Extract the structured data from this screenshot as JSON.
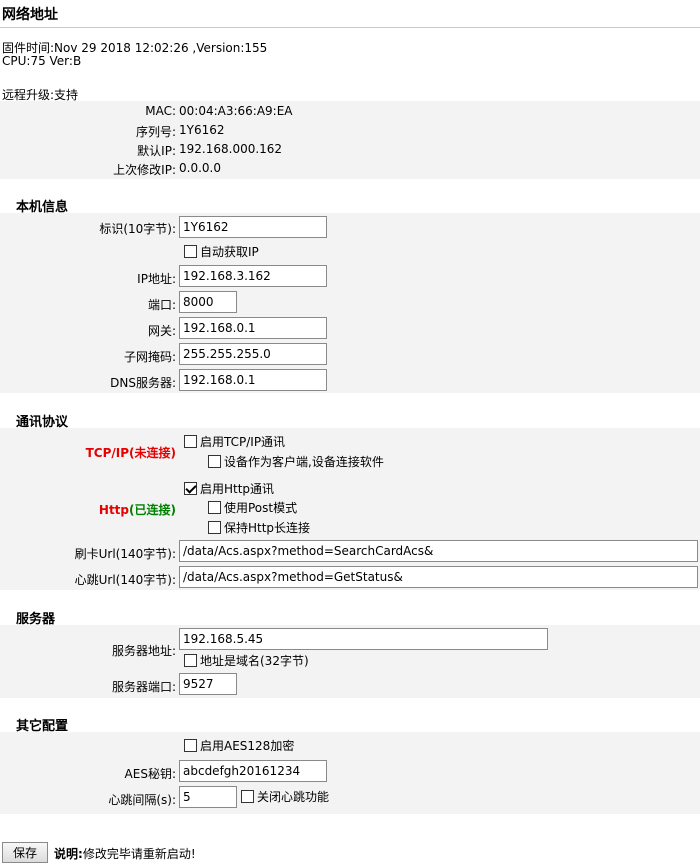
{
  "page_title": "网络地址",
  "firmware_line": "固件时间:Nov 29 2018 12:02:26 ,Version:155",
  "cpu_line": "CPU:75 Ver:B",
  "remote_upgrade": "远程升级:支持",
  "device_info": {
    "mac_label": "MAC:",
    "mac_value": "00:04:A3:66:A9:EA",
    "serial_label": "序列号:",
    "serial_value": "1Y6162",
    "default_ip_label": "默认IP:",
    "default_ip_value": "192.168.000.162",
    "last_ip_label": "上次修改IP:",
    "last_ip_value": "0.0.0.0"
  },
  "local_info": {
    "section_title": "本机信息",
    "id_label": "标识(10字节):",
    "id_value": "1Y6162",
    "auto_ip_label": "自动获取IP",
    "auto_ip_checked": false,
    "ip_label": "IP地址:",
    "ip_value": "192.168.3.162",
    "port_label": "端口:",
    "port_value": "8000",
    "gateway_label": "网关:",
    "gateway_value": "192.168.0.1",
    "mask_label": "子网掩码:",
    "mask_value": "255.255.255.0",
    "dns_label": "DNS服务器:",
    "dns_value": "192.168.0.1"
  },
  "protocol": {
    "section_title": "通讯协议",
    "tcp_label_main": "TCP/IP",
    "tcp_label_status": "(未连接)",
    "tcp_enable_label": "启用TCP/IP通讯",
    "tcp_enable_checked": false,
    "tcp_client_label": "设备作为客户端,设备连接软件",
    "tcp_client_checked": false,
    "http_label_main": "Http",
    "http_label_status": "(已连接)",
    "http_enable_label": "启用Http通讯",
    "http_enable_checked": true,
    "post_mode_label": "使用Post模式",
    "post_mode_checked": false,
    "keepalive_label": "保持Http长连接",
    "keepalive_checked": false,
    "card_url_label": "刷卡Url(140字节):",
    "card_url_value": "/data/Acs.aspx?method=SearchCardAcs&",
    "heartbeat_url_label": "心跳Url(140字节):",
    "heartbeat_url_value": "/data/Acs.aspx?method=GetStatus&"
  },
  "server": {
    "section_title": "服务器",
    "address_label": "服务器地址:",
    "address_value": "192.168.5.45",
    "is_domain_label": "地址是域名(32字节)",
    "is_domain_checked": false,
    "port_label": "服务器端口:",
    "port_value": "9527"
  },
  "other": {
    "section_title": "其它配置",
    "aes_enable_label": "启用AES128加密",
    "aes_enable_checked": false,
    "aes_key_label": "AES秘钥:",
    "aes_key_value": "abcdefgh20161234",
    "heartbeat_interval_label": "心跳间隔(s):",
    "heartbeat_interval_value": "5",
    "heartbeat_off_label": "关闭心跳功能",
    "heartbeat_off_checked": false
  },
  "footer": {
    "save_label": "保存",
    "note_bold": "说明:",
    "note_text": "修改完毕请重新启动!"
  }
}
